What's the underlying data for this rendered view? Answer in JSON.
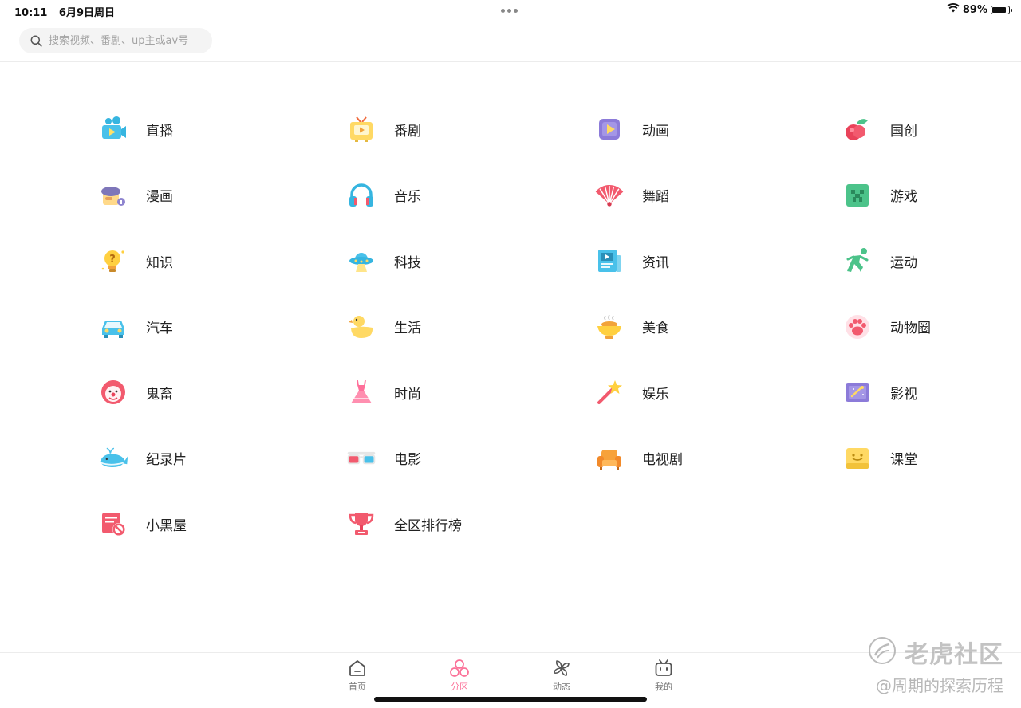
{
  "status_bar": {
    "time": "10:11",
    "date": "6月9日周日",
    "battery_percent": "89%",
    "battery_level": 0.89
  },
  "search": {
    "placeholder": "搜索视频、番剧、up主或av号"
  },
  "categories": [
    {
      "label": "直播",
      "icon": "live-camera-icon"
    },
    {
      "label": "番剧",
      "icon": "tv-icon"
    },
    {
      "label": "动画",
      "icon": "animation-play-icon"
    },
    {
      "label": "国创",
      "icon": "peach-icon"
    },
    {
      "label": "漫画",
      "icon": "comic-beret-icon"
    },
    {
      "label": "音乐",
      "icon": "headphones-icon"
    },
    {
      "label": "舞蹈",
      "icon": "fan-icon"
    },
    {
      "label": "游戏",
      "icon": "game-creeper-icon"
    },
    {
      "label": "知识",
      "icon": "lightbulb-question-icon"
    },
    {
      "label": "科技",
      "icon": "ufo-icon"
    },
    {
      "label": "资讯",
      "icon": "newspaper-icon"
    },
    {
      "label": "运动",
      "icon": "runner-icon"
    },
    {
      "label": "汽车",
      "icon": "car-icon"
    },
    {
      "label": "生活",
      "icon": "duck-icon"
    },
    {
      "label": "美食",
      "icon": "food-bowl-icon"
    },
    {
      "label": "动物圈",
      "icon": "paw-icon"
    },
    {
      "label": "鬼畜",
      "icon": "clown-icon"
    },
    {
      "label": "时尚",
      "icon": "dress-icon"
    },
    {
      "label": "娱乐",
      "icon": "magic-wand-icon"
    },
    {
      "label": "影视",
      "icon": "film-icon"
    },
    {
      "label": "纪录片",
      "icon": "whale-icon"
    },
    {
      "label": "电影",
      "icon": "3d-glasses-icon"
    },
    {
      "label": "电视剧",
      "icon": "sofa-icon"
    },
    {
      "label": "课堂",
      "icon": "classroom-icon"
    },
    {
      "label": "小黑屋",
      "icon": "banned-icon"
    },
    {
      "label": "全区排行榜",
      "icon": "trophy-icon"
    }
  ],
  "bottom_nav": [
    {
      "label": "首页",
      "icon": "home-icon",
      "active": false
    },
    {
      "label": "分区",
      "icon": "categories-icon",
      "active": true
    },
    {
      "label": "动态",
      "icon": "pinwheel-icon",
      "active": false
    },
    {
      "label": "我的",
      "icon": "tv-profile-icon",
      "active": false
    }
  ],
  "watermark": {
    "title": "老虎社区",
    "subtitle": "@周期的探索历程"
  },
  "colors": {
    "accent": "#fb7299",
    "text": "#222222",
    "nav_inactive": "#777777"
  }
}
